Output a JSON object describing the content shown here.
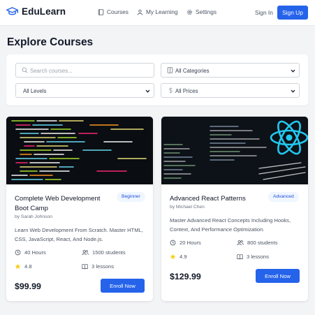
{
  "brand": {
    "name": "EduLearn",
    "accent": "#2563eb"
  },
  "nav": {
    "links": [
      {
        "label": "Courses",
        "icon": "book-icon"
      },
      {
        "label": "My Learning",
        "icon": "user-icon"
      },
      {
        "label": "Settings",
        "icon": "gear-icon"
      }
    ],
    "signin": "Sign In",
    "signup": "Sign Up"
  },
  "page": {
    "title": "Explore Courses"
  },
  "filters": {
    "search_placeholder": "Search courses...",
    "category": "All Categories",
    "level": "All Levels",
    "price": "All Prices"
  },
  "courses": [
    {
      "title": "Complete Web Development Boot Camp",
      "badge": "Beginner",
      "author": "by Sarah Johnson",
      "description": "Learn Web Development From Scratch. Master HTML, CSS, JavaScript, React, And Node.js.",
      "duration": "40 Hours",
      "students": "1500 students",
      "rating": "4.8",
      "lessons": "3 lessons",
      "price": "$99.99",
      "cta": "Enroll Now",
      "image": "code-editor-screenshot"
    },
    {
      "title": "Advanced React Patterns",
      "badge": "Advanced",
      "author": "by Michael Chen",
      "description": "Master Advanced React Concepts Including Hooks, Context, And Performance Optimization.",
      "duration": "20 Hours",
      "students": "800 students",
      "rating": "4.9",
      "lessons": "3 lessons",
      "price": "$129.99",
      "cta": "Enroll Now",
      "image": "react-logo-code-screenshot"
    }
  ]
}
